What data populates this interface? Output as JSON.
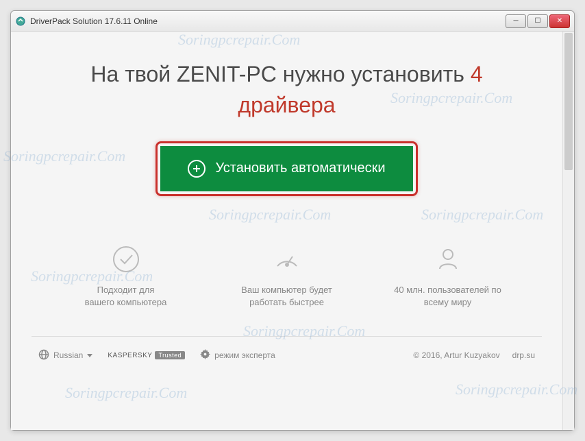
{
  "window": {
    "title": "DriverPack Solution 17.6.11 Online"
  },
  "headline": {
    "prefix": "На твой ZENIT-PC нужно установить",
    "count": "4",
    "suffix": "драйвера"
  },
  "install_button": {
    "label": "Установить автоматически"
  },
  "features": [
    {
      "icon": "check-circle",
      "text_line1": "Подходит для",
      "text_line2": "вашего компьютера"
    },
    {
      "icon": "gauge",
      "text_line1": "Ваш компьютер будет",
      "text_line2": "работать быстрее"
    },
    {
      "icon": "user",
      "text_line1": "40 млн. пользователей по",
      "text_line2": "всему миру"
    }
  ],
  "footer": {
    "language": "Russian",
    "kaspersky": "KASPERSKY",
    "trusted": "Trusted",
    "expert_mode": "режим эксперта",
    "copyright": "© 2016, Artur Kuzyakov",
    "site": "drp.su"
  },
  "watermark": "Soringpcrepair.Com"
}
